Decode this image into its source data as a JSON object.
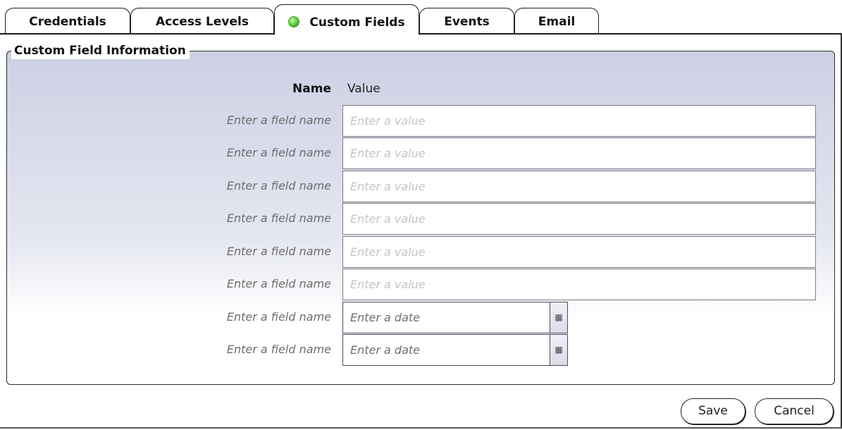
{
  "tabs": [
    {
      "label": "Credentials"
    },
    {
      "label": "Access Levels"
    },
    {
      "label": "Custom Fields"
    },
    {
      "label": "Events"
    },
    {
      "label": "Email"
    }
  ],
  "active_tab": "Custom Fields",
  "section": {
    "legend": "Custom Field Information",
    "name_header": "Name",
    "value_header": "Value"
  },
  "fields": [
    {
      "label": "Enter a field name",
      "placeholder": "Enter a value",
      "kind": "text"
    },
    {
      "label": "Enter a field name",
      "placeholder": "Enter a value",
      "kind": "text"
    },
    {
      "label": "Enter a field name",
      "placeholder": "Enter a value",
      "kind": "text"
    },
    {
      "label": "Enter a field name",
      "placeholder": "Enter a value",
      "kind": "text"
    },
    {
      "label": "Enter a field name",
      "placeholder": "Enter a value",
      "kind": "text"
    },
    {
      "label": "Enter a field name",
      "placeholder": "Enter a value",
      "kind": "text"
    },
    {
      "label": "Enter a field name",
      "placeholder": "Enter a date",
      "kind": "date"
    },
    {
      "label": "Enter a field name",
      "placeholder": "Enter a date",
      "kind": "date"
    }
  ],
  "calendar_icon": "calendar-icon",
  "status_color": "#57cf3c",
  "buttons": {
    "save": "Save",
    "cancel": "Cancel"
  }
}
